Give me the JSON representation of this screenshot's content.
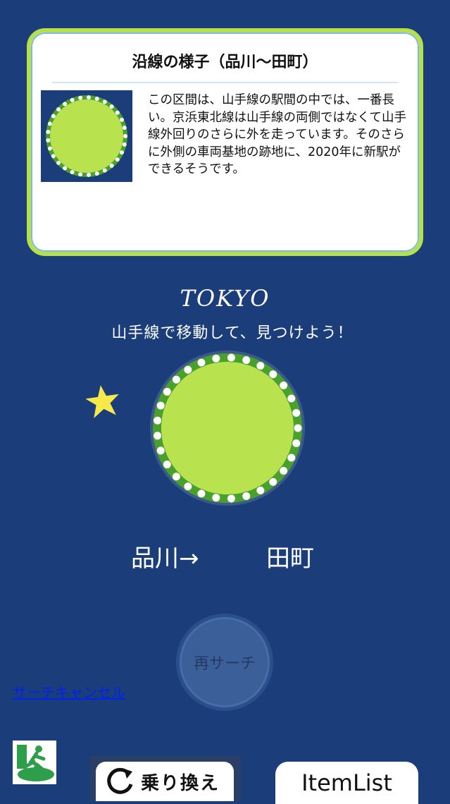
{
  "card": {
    "title": "沿線の様子（品川〜田町）",
    "description": "この区間は、山手線の駅間の中では、一番長い。京浜東北線は山手線の両側ではなくて山手線外回りのさらに外を走っています。そのさらに外側の車両基地の跡地に、2020年に新駅ができるそうです。",
    "thumbnail_icon": "yamanote-line-circle-icon"
  },
  "logo_text": "TOKYO",
  "subtitle": "山手線で移動して、見つけよう！",
  "route": {
    "from": "品川→",
    "to": "田町"
  },
  "buttons": {
    "research": "再サーチ",
    "search_cancel": "サーチキャンセル",
    "transfer": "乗り換え",
    "item_list": "ItemList"
  },
  "colors": {
    "background": "#1b3d7a",
    "accent_green": "#b4e14a",
    "line_green": "#4aa02c",
    "star_yellow": "#f7e94a"
  },
  "icons": {
    "star": "star-icon",
    "exit": "exit-icon",
    "refresh": "refresh-icon"
  }
}
